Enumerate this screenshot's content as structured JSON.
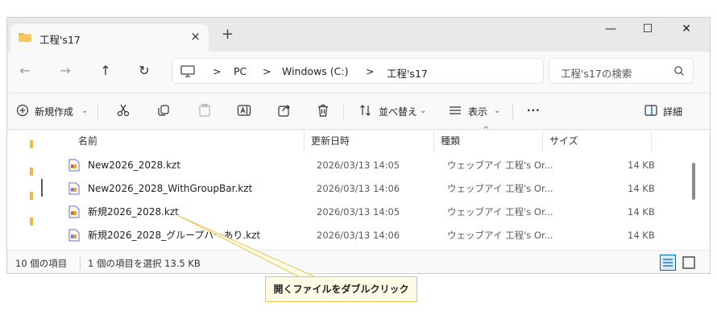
{
  "tab": {
    "title": "工程's17",
    "close": "×",
    "new_tab": "+"
  },
  "window_controls": {
    "minimize": "—",
    "maximize": "☐",
    "close": "✕"
  },
  "nav": {
    "back": "←",
    "forward": "→",
    "up": "↑",
    "refresh": "↻"
  },
  "breadcrumb": {
    "sep1": ">",
    "pc": "PC",
    "sep2": ">",
    "drive": "Windows (C:)",
    "sep3": ">",
    "folder": "工程's17"
  },
  "search": {
    "placeholder": "工程's17の検索"
  },
  "commands": {
    "new": "新規作成",
    "sort": "並べ替え",
    "view": "表示",
    "more": "···",
    "details": "詳細"
  },
  "columns": {
    "name": "名前",
    "modified": "更新日時",
    "type": "種類",
    "size": "サイズ"
  },
  "files": [
    {
      "name": "New2026_2028.kzt",
      "modified": "2026/03/13 14:05",
      "type": "ウェッブアイ 工程's Or...",
      "size": "14 KB"
    },
    {
      "name": "New2026_2028_WithGroupBar.kzt",
      "modified": "2026/03/13 14:06",
      "type": "ウェッブアイ 工程's Or...",
      "size": "14 KB"
    },
    {
      "name": "新規2026_2028.kzt",
      "modified": "2026/03/13 14:05",
      "type": "ウェッブアイ 工程's Or...",
      "size": "14 KB"
    },
    {
      "name": "新規2026_2028_グループバーあり.kzt",
      "modified": "2026/03/13 14:06",
      "type": "ウェッブアイ 工程's Or...",
      "size": "14 KB"
    }
  ],
  "status": {
    "count": "10 個の項目",
    "selected": "1 個の項目を選択 13.5 KB"
  },
  "callout": {
    "text": "開くファイルをダブルクリック"
  },
  "colors": {
    "accent": "#0067c0",
    "folder": "#e9b949",
    "callout_border": "#e8c55a",
    "callout_bg": "#fffbe6"
  }
}
